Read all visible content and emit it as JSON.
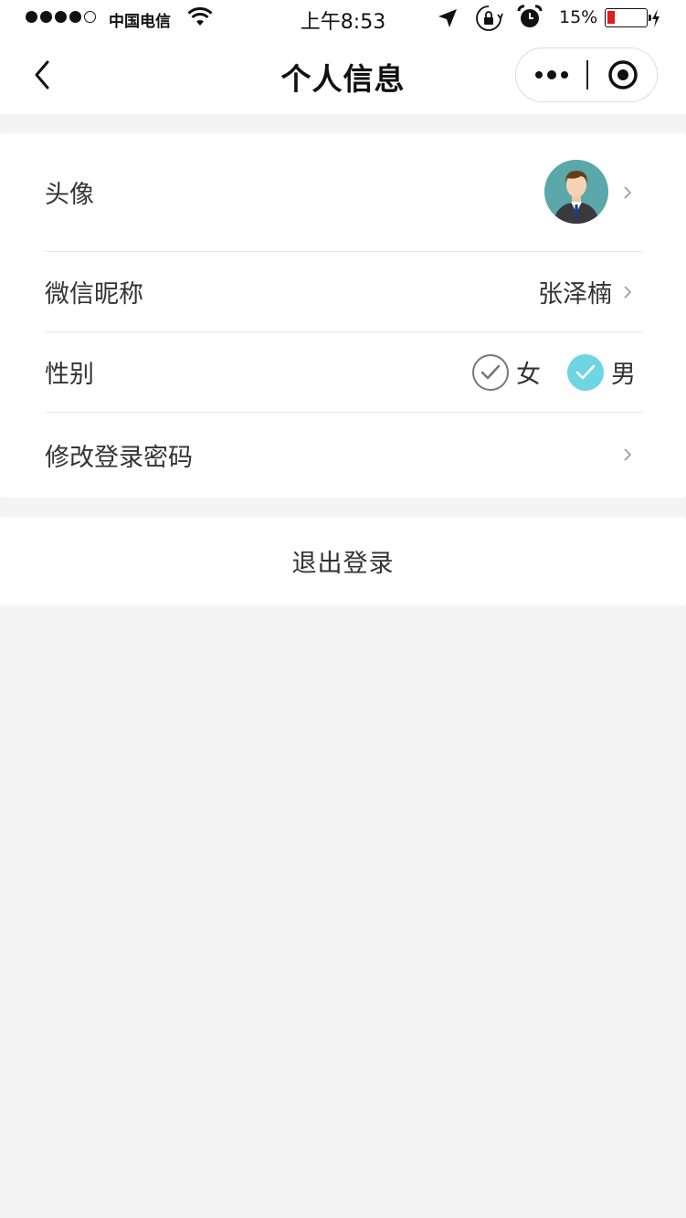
{
  "status_bar": {
    "signal_filled": 4,
    "signal_total": 5,
    "carrier": "中国电信",
    "time": "上午8:53",
    "battery_percent": "15%",
    "battery_level": 0.15,
    "icons": [
      "wifi-icon",
      "location-arrow-icon",
      "rotation-lock-icon",
      "alarm-clock-icon",
      "battery-icon",
      "charging-bolt-icon"
    ]
  },
  "nav": {
    "title": "个人信息",
    "back_icon": "chevron-left-icon",
    "more_icon": "more-dots-icon",
    "close_icon": "target-circle-icon"
  },
  "profile": {
    "avatar_label": "头像",
    "avatar_icon": "businessman-avatar-icon",
    "nickname_label": "微信昵称",
    "nickname_value": "张泽楠",
    "gender_label": "性别",
    "gender_options": [
      {
        "label": "女",
        "selected": false
      },
      {
        "label": "男",
        "selected": true
      }
    ],
    "password_label": "修改登录密码"
  },
  "logout": {
    "label": "退出登录"
  },
  "colors": {
    "background": "#f4f4f4",
    "card": "#ffffff",
    "accent": "#6dd5e4",
    "battery_low": "#e21b1b",
    "avatar_bg": "#5aa8aa"
  }
}
